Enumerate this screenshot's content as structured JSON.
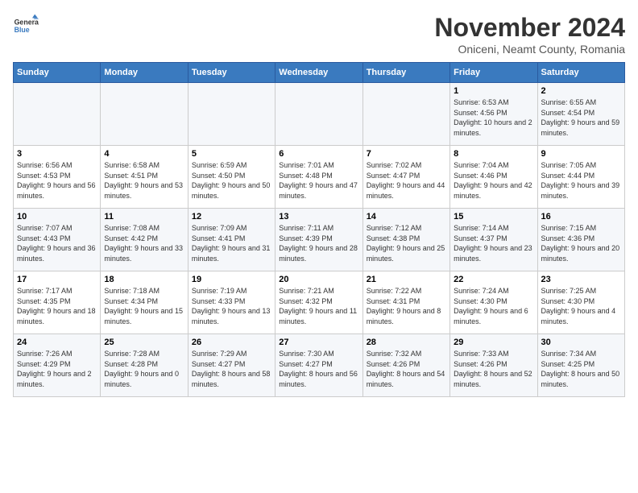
{
  "logo": {
    "line1": "General",
    "line2": "Blue"
  },
  "title": "November 2024",
  "subtitle": "Oniceni, Neamt County, Romania",
  "weekdays": [
    "Sunday",
    "Monday",
    "Tuesday",
    "Wednesday",
    "Thursday",
    "Friday",
    "Saturday"
  ],
  "weeks": [
    [
      {
        "day": "",
        "sunrise": "",
        "sunset": "",
        "daylight": ""
      },
      {
        "day": "",
        "sunrise": "",
        "sunset": "",
        "daylight": ""
      },
      {
        "day": "",
        "sunrise": "",
        "sunset": "",
        "daylight": ""
      },
      {
        "day": "",
        "sunrise": "",
        "sunset": "",
        "daylight": ""
      },
      {
        "day": "",
        "sunrise": "",
        "sunset": "",
        "daylight": ""
      },
      {
        "day": "1",
        "sunrise": "Sunrise: 6:53 AM",
        "sunset": "Sunset: 4:56 PM",
        "daylight": "Daylight: 10 hours and 2 minutes."
      },
      {
        "day": "2",
        "sunrise": "Sunrise: 6:55 AM",
        "sunset": "Sunset: 4:54 PM",
        "daylight": "Daylight: 9 hours and 59 minutes."
      }
    ],
    [
      {
        "day": "3",
        "sunrise": "Sunrise: 6:56 AM",
        "sunset": "Sunset: 4:53 PM",
        "daylight": "Daylight: 9 hours and 56 minutes."
      },
      {
        "day": "4",
        "sunrise": "Sunrise: 6:58 AM",
        "sunset": "Sunset: 4:51 PM",
        "daylight": "Daylight: 9 hours and 53 minutes."
      },
      {
        "day": "5",
        "sunrise": "Sunrise: 6:59 AM",
        "sunset": "Sunset: 4:50 PM",
        "daylight": "Daylight: 9 hours and 50 minutes."
      },
      {
        "day": "6",
        "sunrise": "Sunrise: 7:01 AM",
        "sunset": "Sunset: 4:48 PM",
        "daylight": "Daylight: 9 hours and 47 minutes."
      },
      {
        "day": "7",
        "sunrise": "Sunrise: 7:02 AM",
        "sunset": "Sunset: 4:47 PM",
        "daylight": "Daylight: 9 hours and 44 minutes."
      },
      {
        "day": "8",
        "sunrise": "Sunrise: 7:04 AM",
        "sunset": "Sunset: 4:46 PM",
        "daylight": "Daylight: 9 hours and 42 minutes."
      },
      {
        "day": "9",
        "sunrise": "Sunrise: 7:05 AM",
        "sunset": "Sunset: 4:44 PM",
        "daylight": "Daylight: 9 hours and 39 minutes."
      }
    ],
    [
      {
        "day": "10",
        "sunrise": "Sunrise: 7:07 AM",
        "sunset": "Sunset: 4:43 PM",
        "daylight": "Daylight: 9 hours and 36 minutes."
      },
      {
        "day": "11",
        "sunrise": "Sunrise: 7:08 AM",
        "sunset": "Sunset: 4:42 PM",
        "daylight": "Daylight: 9 hours and 33 minutes."
      },
      {
        "day": "12",
        "sunrise": "Sunrise: 7:09 AM",
        "sunset": "Sunset: 4:41 PM",
        "daylight": "Daylight: 9 hours and 31 minutes."
      },
      {
        "day": "13",
        "sunrise": "Sunrise: 7:11 AM",
        "sunset": "Sunset: 4:39 PM",
        "daylight": "Daylight: 9 hours and 28 minutes."
      },
      {
        "day": "14",
        "sunrise": "Sunrise: 7:12 AM",
        "sunset": "Sunset: 4:38 PM",
        "daylight": "Daylight: 9 hours and 25 minutes."
      },
      {
        "day": "15",
        "sunrise": "Sunrise: 7:14 AM",
        "sunset": "Sunset: 4:37 PM",
        "daylight": "Daylight: 9 hours and 23 minutes."
      },
      {
        "day": "16",
        "sunrise": "Sunrise: 7:15 AM",
        "sunset": "Sunset: 4:36 PM",
        "daylight": "Daylight: 9 hours and 20 minutes."
      }
    ],
    [
      {
        "day": "17",
        "sunrise": "Sunrise: 7:17 AM",
        "sunset": "Sunset: 4:35 PM",
        "daylight": "Daylight: 9 hours and 18 minutes."
      },
      {
        "day": "18",
        "sunrise": "Sunrise: 7:18 AM",
        "sunset": "Sunset: 4:34 PM",
        "daylight": "Daylight: 9 hours and 15 minutes."
      },
      {
        "day": "19",
        "sunrise": "Sunrise: 7:19 AM",
        "sunset": "Sunset: 4:33 PM",
        "daylight": "Daylight: 9 hours and 13 minutes."
      },
      {
        "day": "20",
        "sunrise": "Sunrise: 7:21 AM",
        "sunset": "Sunset: 4:32 PM",
        "daylight": "Daylight: 9 hours and 11 minutes."
      },
      {
        "day": "21",
        "sunrise": "Sunrise: 7:22 AM",
        "sunset": "Sunset: 4:31 PM",
        "daylight": "Daylight: 9 hours and 8 minutes."
      },
      {
        "day": "22",
        "sunrise": "Sunrise: 7:24 AM",
        "sunset": "Sunset: 4:30 PM",
        "daylight": "Daylight: 9 hours and 6 minutes."
      },
      {
        "day": "23",
        "sunrise": "Sunrise: 7:25 AM",
        "sunset": "Sunset: 4:30 PM",
        "daylight": "Daylight: 9 hours and 4 minutes."
      }
    ],
    [
      {
        "day": "24",
        "sunrise": "Sunrise: 7:26 AM",
        "sunset": "Sunset: 4:29 PM",
        "daylight": "Daylight: 9 hours and 2 minutes."
      },
      {
        "day": "25",
        "sunrise": "Sunrise: 7:28 AM",
        "sunset": "Sunset: 4:28 PM",
        "daylight": "Daylight: 9 hours and 0 minutes."
      },
      {
        "day": "26",
        "sunrise": "Sunrise: 7:29 AM",
        "sunset": "Sunset: 4:27 PM",
        "daylight": "Daylight: 8 hours and 58 minutes."
      },
      {
        "day": "27",
        "sunrise": "Sunrise: 7:30 AM",
        "sunset": "Sunset: 4:27 PM",
        "daylight": "Daylight: 8 hours and 56 minutes."
      },
      {
        "day": "28",
        "sunrise": "Sunrise: 7:32 AM",
        "sunset": "Sunset: 4:26 PM",
        "daylight": "Daylight: 8 hours and 54 minutes."
      },
      {
        "day": "29",
        "sunrise": "Sunrise: 7:33 AM",
        "sunset": "Sunset: 4:26 PM",
        "daylight": "Daylight: 8 hours and 52 minutes."
      },
      {
        "day": "30",
        "sunrise": "Sunrise: 7:34 AM",
        "sunset": "Sunset: 4:25 PM",
        "daylight": "Daylight: 8 hours and 50 minutes."
      }
    ]
  ]
}
